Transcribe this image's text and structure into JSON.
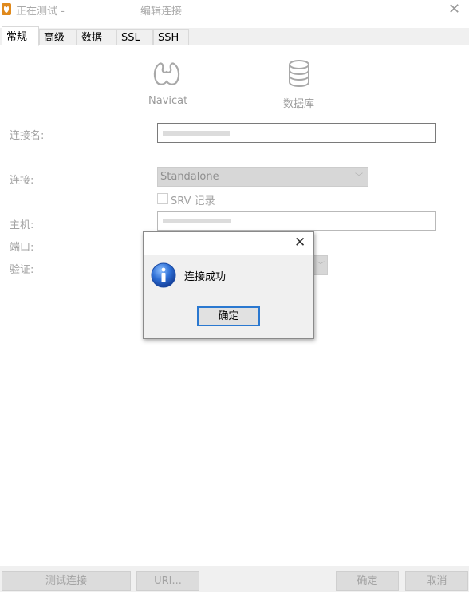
{
  "window": {
    "title_left": "正在测试 -",
    "title_center": "编辑连接",
    "close_glyph": "✕"
  },
  "tabs": [
    {
      "label": "常规"
    },
    {
      "label": "高级"
    },
    {
      "label": "数据库"
    },
    {
      "label": "SSL"
    },
    {
      "label": "SSH"
    }
  ],
  "diagram": {
    "left_label": "Navicat",
    "right_label": "数据库",
    "left_icon": "navicat-logo-icon",
    "right_icon": "database-icon"
  },
  "form": {
    "connection_name_label": "连接名:",
    "connection_label": "连接:",
    "connection_value": "Standalone",
    "srv_label": "SRV 记录",
    "host_label": "主机:",
    "port_label": "端口:",
    "auth_label": "验证:"
  },
  "dialog": {
    "message": "连接成功",
    "ok_label": "确定",
    "close_glyph": "✕",
    "icon": "info-icon"
  },
  "footer": {
    "test_label": "测试连接",
    "uri_label": "URI...",
    "ok_label": "确定",
    "cancel_label": "取消"
  },
  "colors": {
    "accent": "#2a78d0",
    "disabled_text": "#a3a3a3",
    "app_icon": "#e0891c"
  }
}
